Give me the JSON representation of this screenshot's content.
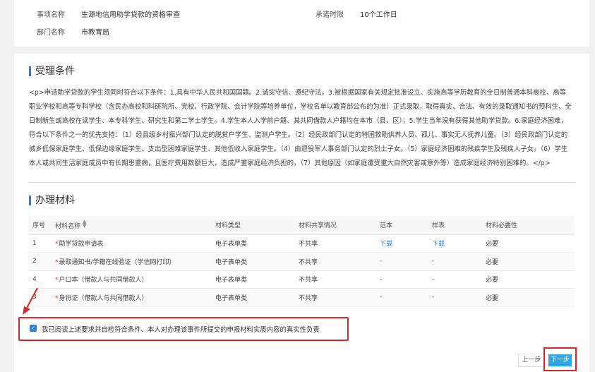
{
  "info": {
    "item_name_label": "事项名称",
    "item_name_value": "生源地信用助学贷款的资格审查",
    "promise_label": "承诺时限",
    "promise_value": "10个工作日",
    "dept_label": "部门名称",
    "dept_value": "市教育局"
  },
  "conditions": {
    "title": "受理条件",
    "text": "<p>申请助学贷款的学生须同时符合以下条件：1.具有中华人民共和国国籍。2.诚实守信、遵纪守法。3.被根据国家有关规定批准设立、实施高等学历教育的全日制普通本科高校、高等职业学校和高等专科学校（含民办高校和科研院所、党校、行政学院、会计学院等培养单位，学校名单以教育部公布的为准）正式录取，取得真实、合法、有效的录取通知书的预科生、全日制新生或高校在读学生、本专科学生、研究生和第二学士学生。4.学生本人入学前户籍、其共同借款人户籍均在本市（县、区）；5.学生当年没有获得其他助学贷款。6.家庭经济困难，符合以下条件之一的优先支持：（1）经县级乡村振兴部门认定的脱贫户学生、监测户学生。（2）经民政部门认定的特困救助供养人员、孤儿、事实无人抚养儿童。（3）经民政部门认定的城乡低保家庭学生、低保边缘家庭学生、支出型困难家庭学生、其他低收入家庭学生。（4）由退役军人事务部门认定的烈士子女。（5）家庭经济困难的残疾学生及残疾人子女。（6）学生本人或共同生活家庭成员中有长期患重病，且医疗费用数额巨大，造成严重家庭经济负担的。（7）其他原因（如家庭遭受重大自然灾害或意外等）造成家庭经济特别困难的。</p>"
  },
  "materials": {
    "title": "办理材料",
    "columns": [
      "序号",
      "材料名称",
      "材料类型",
      "材料共享情况",
      "范本",
      "样表",
      "材料必要性"
    ],
    "rows": [
      {
        "no": "1",
        "name": "助学贷款申请表",
        "type": "电子表单类",
        "share": "不共享",
        "template": "下载",
        "sample": "下载",
        "required": "必要"
      },
      {
        "no": "2",
        "name": "录取通知书/学籍在线验证（学信网打印）",
        "type": "电子表单类",
        "share": "不共享",
        "template": "-",
        "sample": "-",
        "required": "必要"
      },
      {
        "no": "4",
        "name": "户口本（借款人与共同借款人）",
        "type": "电子表单类",
        "share": "不共享",
        "template": "-",
        "sample": "-",
        "required": "必要"
      },
      {
        "no": "3",
        "name": "身份证（借款人与共同借款人）",
        "type": "电子表单类",
        "share": "不共享",
        "template": "-",
        "sample": "-",
        "required": "必要"
      }
    ]
  },
  "agreement": {
    "text": "我已阅读上述要求并自检符合条件、本人对办理该事件所提交的申报材料实质内容的真实性负责",
    "checked": true
  },
  "buttons": {
    "prev": "上一步",
    "next": "下一步"
  },
  "colors": {
    "accent": "#2a7fd4",
    "highlight": "#d9272e",
    "next_button": "#2fa7e4"
  }
}
